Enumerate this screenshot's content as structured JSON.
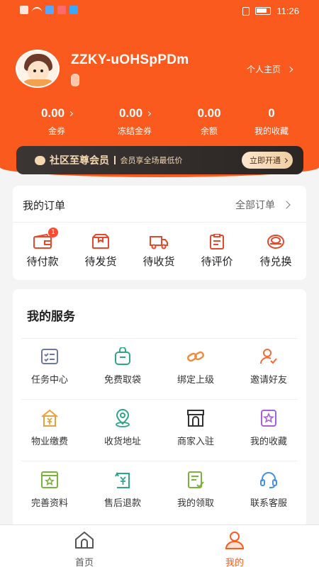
{
  "status_bar": {
    "time": "11:26"
  },
  "profile": {
    "username": "ZZKY-uOHSpPDm",
    "homepage_link": "个人主页"
  },
  "stats": [
    {
      "value": "0.00",
      "label": "金券",
      "has_arrow": true
    },
    {
      "value": "0.00",
      "label": "冻结金券",
      "has_arrow": true
    },
    {
      "value": "0.00",
      "label": "余额",
      "has_arrow": false
    },
    {
      "value": "0",
      "label": "我的收藏",
      "has_arrow": false
    }
  ],
  "vip_banner": {
    "title": "社区至尊会员",
    "description": "会员享全场最低价",
    "button": "立即开通"
  },
  "orders": {
    "title": "我的订单",
    "all_link": "全部订单",
    "items": [
      {
        "label": "待付款",
        "icon": "wallet-icon",
        "badge": "1"
      },
      {
        "label": "待发货",
        "icon": "package-icon"
      },
      {
        "label": "待收货",
        "icon": "truck-icon"
      },
      {
        "label": "待评价",
        "icon": "clipboard-icon"
      },
      {
        "label": "待兑换",
        "icon": "coins-icon"
      }
    ]
  },
  "services": {
    "title": "我的服务",
    "items": [
      {
        "label": "任务中心",
        "icon": "task-list-icon",
        "color": "#6f7a9a"
      },
      {
        "label": "免费取袋",
        "icon": "bag-icon",
        "color": "#2fa58c"
      },
      {
        "label": "绑定上级",
        "icon": "link-icon",
        "color": "#f08a3c"
      },
      {
        "label": "邀请好友",
        "icon": "invite-user-icon",
        "color": "#f06b3c"
      },
      {
        "label": "物业缴费",
        "icon": "house-payment-icon",
        "color": "#e9a23b"
      },
      {
        "label": "收货地址",
        "icon": "location-pin-icon",
        "color": "#2fa58c"
      },
      {
        "label": "商家入驻",
        "icon": "storefront-icon",
        "color": "#333333"
      },
      {
        "label": "我的收藏",
        "icon": "star-icon",
        "color": "#a860d8"
      },
      {
        "label": "完善资料",
        "icon": "profile-star-icon",
        "color": "#7ab33c"
      },
      {
        "label": "售后退款",
        "icon": "refund-icon",
        "color": "#2fa58c"
      },
      {
        "label": "我的领取",
        "icon": "document-icon",
        "color": "#7ab33c"
      },
      {
        "label": "联系客服",
        "icon": "headset-icon",
        "color": "#4a90e2"
      }
    ]
  },
  "tabbar": {
    "items": [
      {
        "label": "首页",
        "icon": "home-icon"
      },
      {
        "label": "我的",
        "icon": "person-icon"
      }
    ],
    "active_color": "#fb5a1f"
  },
  "colors": {
    "brand": "#fb5a1f",
    "vip_bg": "#2f2927",
    "vip_text": "#f4d8b2"
  }
}
